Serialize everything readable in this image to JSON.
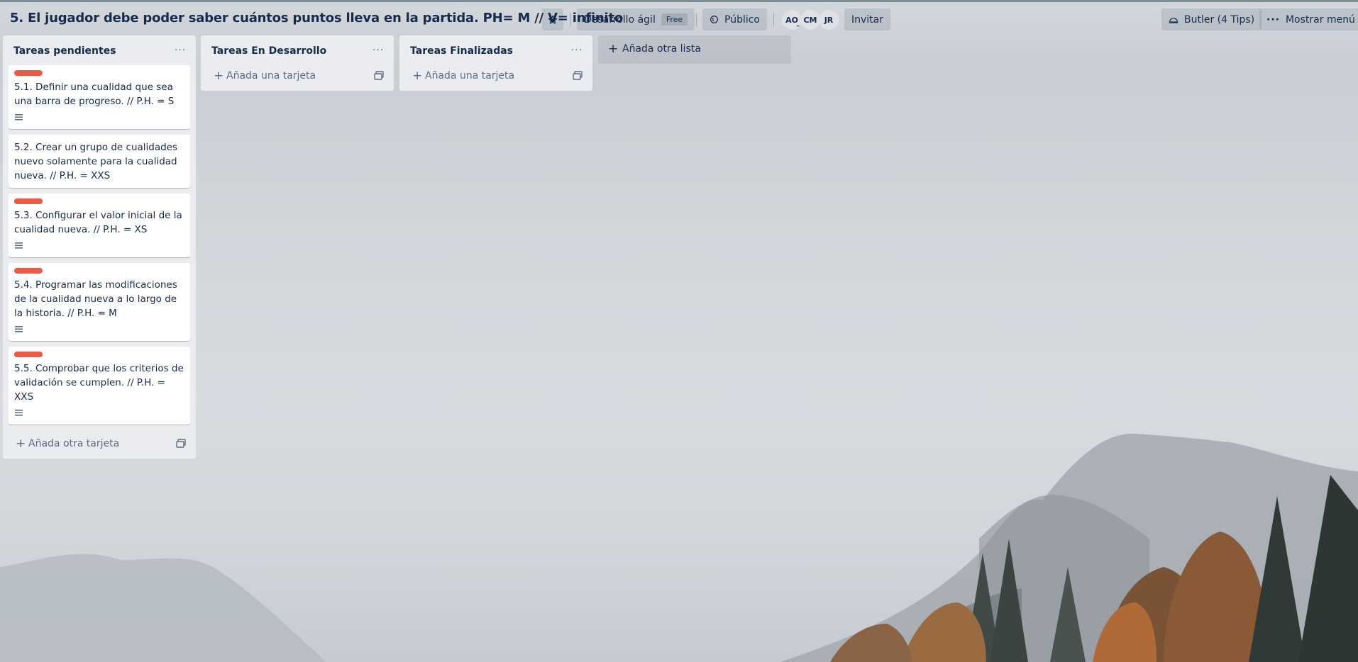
{
  "board": {
    "title": "5. El jugador debe poder saber cuántos puntos lleva en la partida. PH= M // V= infinito",
    "workspace": "Desarrollo ágil",
    "plan_badge": "Free",
    "visibility": "Público",
    "members": [
      "AO",
      "CM",
      "JR"
    ],
    "invite_label": "Invitar",
    "butler_label": "Butler (4 Tips)",
    "menu_label": "Mostrar menú",
    "star_icon": "star-icon",
    "globe_icon": "globe-icon",
    "butler_icon": "butler-icon",
    "dots_icon": "dots-icon"
  },
  "lists": [
    {
      "title": "Tareas pendientes",
      "add_label": "Añada otra tarjeta",
      "cards": [
        {
          "text": "5.1. Definir una cualidad que sea una barra de progreso. // P.H. = S",
          "label_color": "#eb5a46",
          "has_description": true
        },
        {
          "text": "5.2. Crear un grupo de cualidades nuevo solamente para la cualidad nueva. // P.H. = XXS",
          "label_color": null,
          "has_description": false
        },
        {
          "text": "5.3. Configurar el valor inicial de la cualidad nueva. // P.H. = XS",
          "label_color": "#eb5a46",
          "has_description": true
        },
        {
          "text": "5.4. Programar las modificaciones de la cualidad nueva a lo largo de la historia. // P.H. = M",
          "label_color": "#eb5a46",
          "has_description": true
        },
        {
          "text": "5.5. Comprobar que los criterios de validación se cumplen. // P.H. = XXS",
          "label_color": "#eb5a46",
          "has_description": true
        }
      ]
    },
    {
      "title": "Tareas En Desarrollo",
      "add_label": "Añada una tarjeta",
      "cards": []
    },
    {
      "title": "Tareas Finalizadas",
      "add_label": "Añada una tarjeta",
      "cards": []
    }
  ],
  "add_list_label": "Añada otra lista",
  "colors": {
    "label_red": "#eb5a46",
    "list_bg": "#ebecf0",
    "text": "#172b4d"
  }
}
